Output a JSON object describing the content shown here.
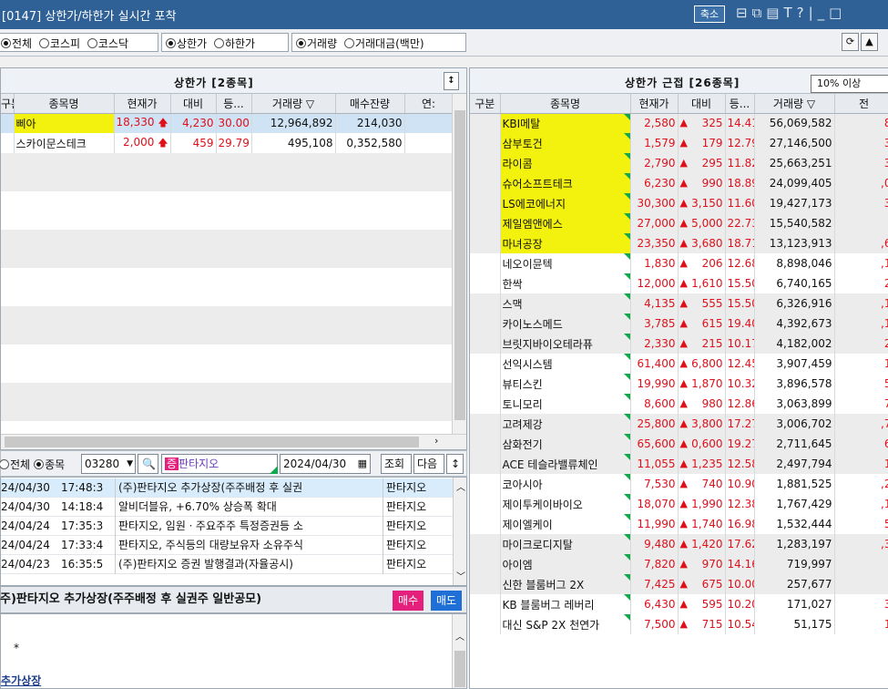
{
  "window": {
    "title": "[0147] 상한가/하한가 실시간 포착",
    "shrink_label": "축소",
    "icons_text": "⊟⧉▤T?|_□"
  },
  "filter": {
    "market_options": [
      "전체",
      "코스피",
      "코스닥"
    ],
    "limit_options": [
      "상한가",
      "하한가"
    ],
    "sort_options": [
      "거래량",
      "거래대금(백만)"
    ]
  },
  "upper_panel": {
    "title": "상한가 [2종목]",
    "columns": [
      "구분",
      "종목명",
      "현재가",
      "대비",
      "등...",
      "거래량 ▽",
      "매수잔량",
      "연:"
    ],
    "rows": [
      {
        "type": "",
        "name": "삐아",
        "price": "18,330",
        "change": "4,230",
        "rate": "30.00",
        "volume": "12,964,892",
        "bid": "214,030"
      },
      {
        "type": "",
        "name": "스카이문스테크",
        "price": "2,000",
        "change": "459",
        "rate": "29.79",
        "volume": "495,108",
        "bid": "0,352,580"
      }
    ]
  },
  "near_panel": {
    "title": "상한가 근접 [26종목]",
    "threshold": "10% 이상",
    "columns": [
      "구분",
      "종목명",
      "현재가",
      "대비",
      "등...",
      "거래량 ▽",
      "전"
    ],
    "rows": [
      {
        "name": "KBI메탈",
        "price": "2,580",
        "change": "325",
        "rate": "14.41",
        "volume": "56,069,582",
        "extra": "8"
      },
      {
        "name": "삼부토건",
        "price": "1,579",
        "change": "179",
        "rate": "12.79",
        "volume": "27,146,500",
        "extra": "3"
      },
      {
        "name": "라이콤",
        "price": "2,790",
        "change": "295",
        "rate": "11.82",
        "volume": "25,663,251",
        "extra": "3"
      },
      {
        "name": "슈어소프트테크",
        "price": "6,230",
        "change": "990",
        "rate": "18.89",
        "volume": "24,099,405",
        "extra": ",0"
      },
      {
        "name": "LS에코에너지",
        "price": "30,300",
        "change": "3,150",
        "rate": "11.60",
        "volume": "19,427,173",
        "extra": "3"
      },
      {
        "name": "제일엠앤에스",
        "price": "27,000",
        "change": "5,000",
        "rate": "22.73",
        "volume": "15,540,582",
        "extra": ""
      },
      {
        "name": "마녀공장",
        "price": "23,350",
        "change": "3,680",
        "rate": "18.71",
        "volume": "13,123,913",
        "extra": ",6"
      },
      {
        "name": "네오이뮨텍",
        "price": "1,830",
        "change": "206",
        "rate": "12.68",
        "volume": "8,898,046",
        "extra": ",1"
      },
      {
        "name": "한싹",
        "price": "12,000",
        "change": "1,610",
        "rate": "15.50",
        "volume": "6,740,165",
        "extra": "2"
      },
      {
        "name": "스맥",
        "price": "4,135",
        "change": "555",
        "rate": "15.50",
        "volume": "6,326,916",
        "extra": ",1"
      },
      {
        "name": "카이노스메드",
        "price": "3,785",
        "change": "615",
        "rate": "19.40",
        "volume": "4,392,673",
        "extra": ",1"
      },
      {
        "name": "브릿지바이오테라퓨",
        "price": "2,330",
        "change": "215",
        "rate": "10.17",
        "volume": "4,182,002",
        "extra": "2"
      },
      {
        "name": "선익시스템",
        "price": "61,400",
        "change": "6,800",
        "rate": "12.45",
        "volume": "3,907,459",
        "extra": "1"
      },
      {
        "name": "뷰티스킨",
        "price": "19,990",
        "change": "1,870",
        "rate": "10.32",
        "volume": "3,896,578",
        "extra": "5"
      },
      {
        "name": "토니모리",
        "price": "8,600",
        "change": "980",
        "rate": "12.86",
        "volume": "3,063,899",
        "extra": "7"
      },
      {
        "name": "고려제강",
        "price": "25,800",
        "change": "3,800",
        "rate": "17.27",
        "volume": "3,006,702",
        "extra": ",7"
      },
      {
        "name": "삼화전기",
        "price": "65,600",
        "change": "0,600",
        "rate": "19.27",
        "volume": "2,711,645",
        "extra": "6"
      },
      {
        "name": "ACE 테슬라밸류체인",
        "price": "11,055",
        "change": "1,235",
        "rate": "12.58",
        "volume": "2,497,794",
        "extra": "1"
      },
      {
        "name": "코아시아",
        "price": "7,530",
        "change": "740",
        "rate": "10.90",
        "volume": "1,881,525",
        "extra": ",2"
      },
      {
        "name": "제이투케이바이오",
        "price": "18,070",
        "change": "1,990",
        "rate": "12.38",
        "volume": "1,767,429",
        "extra": ",1"
      },
      {
        "name": "제이엘케이",
        "price": "11,990",
        "change": "1,740",
        "rate": "16.98",
        "volume": "1,532,444",
        "extra": "5"
      },
      {
        "name": "마이크로디지탈",
        "price": "9,480",
        "change": "1,420",
        "rate": "17.62",
        "volume": "1,283,197",
        "extra": ",3"
      },
      {
        "name": "아이엠",
        "price": "7,820",
        "change": "970",
        "rate": "14.16",
        "volume": "719,997",
        "extra": ""
      },
      {
        "name": "신한 블룸버그 2X",
        "price": "7,425",
        "change": "675",
        "rate": "10.00",
        "volume": "257,677",
        "extra": ""
      },
      {
        "name": "KB 블룸버그 레버리",
        "price": "6,430",
        "change": "595",
        "rate": "10.20",
        "volume": "171,027",
        "extra": "3"
      },
      {
        "name": "대신 S&P 2X 천연가",
        "price": "7,500",
        "change": "715",
        "rate": "10.54",
        "volume": "51,175",
        "extra": "1"
      }
    ]
  },
  "news_filter": {
    "scope_all": "전체",
    "scope_stock": "종목",
    "code": "03280",
    "stock_badge": "증",
    "stock_name": "판타지오",
    "date": "2024/04/30",
    "search_label": "조회",
    "next_label": "다음"
  },
  "news": [
    {
      "date": "24/04/30",
      "time": "17:48:3",
      "headline": "(주)판타지오 추가상장(주주배정 후 실권",
      "stock": "판타지오"
    },
    {
      "date": "24/04/30",
      "time": "14:18:4",
      "headline": "알비더블유, +6.70% 상승폭 확대",
      "stock": "판타지오"
    },
    {
      "date": "24/04/24",
      "time": "17:35:3",
      "headline": "판타지오, 임원ㆍ주요주주 특정증권등 소",
      "stock": "판타지오"
    },
    {
      "date": "24/04/24",
      "time": "17:33:4",
      "headline": "판타지오, 주식등의 대량보유자 소유주식",
      "stock": "판타지오"
    },
    {
      "date": "24/04/23",
      "time": "16:35:5",
      "headline": "(주)판타지오 증권 발행결과(자율공시)",
      "stock": "판타지오"
    }
  ],
  "news_detail": {
    "title": "주)판타지오 추가상장(주주배정 후 실권주 일반공모)",
    "buy_label": "매수",
    "sell_label": "매도",
    "asterisk": "*",
    "section": "추가상장"
  }
}
